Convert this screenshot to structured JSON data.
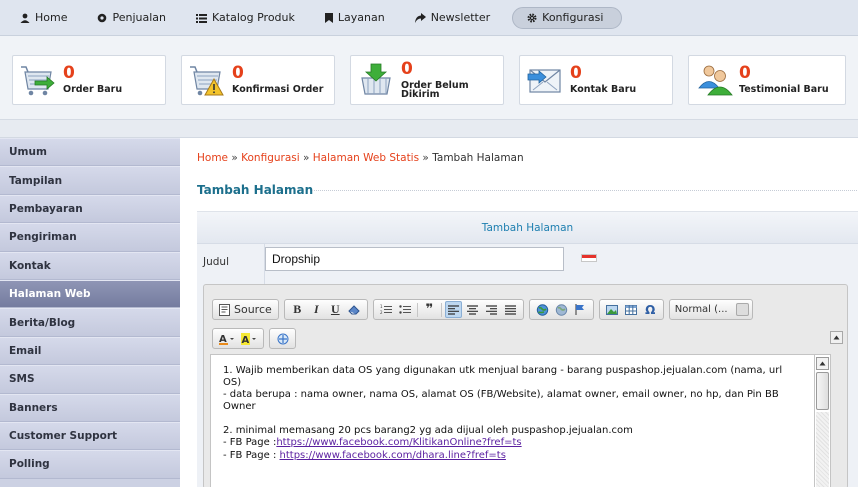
{
  "nav": {
    "items": [
      {
        "label": "Home",
        "icon": "user-icon"
      },
      {
        "label": "Penjualan",
        "icon": "circle-icon"
      },
      {
        "label": "Katalog Produk",
        "icon": "list-icon"
      },
      {
        "label": "Layanan",
        "icon": "bookmark-icon"
      },
      {
        "label": "Newsletter",
        "icon": "share-icon"
      },
      {
        "label": "Konfigurasi",
        "icon": "gear-icon"
      }
    ],
    "active": "Konfigurasi"
  },
  "stats": [
    {
      "count": "0",
      "label": "Order Baru",
      "icon": "cart-icon"
    },
    {
      "count": "0",
      "label": "Konfirmasi Order",
      "icon": "cart-warning-icon"
    },
    {
      "count": "0",
      "label": "Order Belum Dikirim",
      "icon": "basket-down-icon"
    },
    {
      "count": "0",
      "label": "Kontak Baru",
      "icon": "mail-icon"
    },
    {
      "count": "0",
      "label": "Testimonial Baru",
      "icon": "users-icon"
    }
  ],
  "sidebar": {
    "items": [
      {
        "label": "Umum"
      },
      {
        "label": "Tampilan"
      },
      {
        "label": "Pembayaran"
      },
      {
        "label": "Pengiriman"
      },
      {
        "label": "Kontak"
      },
      {
        "label": "Halaman Web"
      },
      {
        "label": "Berita/Blog"
      },
      {
        "label": "Email"
      },
      {
        "label": "SMS"
      },
      {
        "label": "Banners"
      },
      {
        "label": "Customer Support"
      },
      {
        "label": "Polling"
      }
    ],
    "active": "Halaman Web"
  },
  "breadcrumb": {
    "home": "Home",
    "konfigurasi": "Konfigurasi",
    "halaman": "Halaman Web Statis",
    "current": "Tambah Halaman",
    "separator": "»"
  },
  "section": {
    "title": "Tambah Halaman"
  },
  "form": {
    "header": "Tambah Halaman",
    "judul_label": "Judul",
    "judul_value": "Dropship"
  },
  "editor": {
    "source_label": "Source",
    "format_value": "Normal (...",
    "content": {
      "line1": "1. Wajib memberikan data OS yang digunakan utk menjual barang - barang puspashop.jejualan.com (nama, url OS)",
      "line2": "- data berupa : nama owner, nama OS, alamat OS (FB/Website), alamat owner, email owner, no hp, dan Pin BB Owner",
      "line3": "2. minimal memasang 20 pcs barang2 yg ada dijual oleh puspashop.jejualan.com",
      "fb1_prefix": "- FB Page :",
      "fb1_link": "https://www.facebook.com/KlitikanOnline?fref=ts",
      "fb2_prefix": "- FB Page : ",
      "fb2_link": "https://www.facebook.com/dhara.line?fref=ts"
    }
  },
  "colors": {
    "accent": "#e5411b",
    "title": "#1c6f8c",
    "sidebar_active": "#7f86a8",
    "link": "#5a1fa0"
  }
}
